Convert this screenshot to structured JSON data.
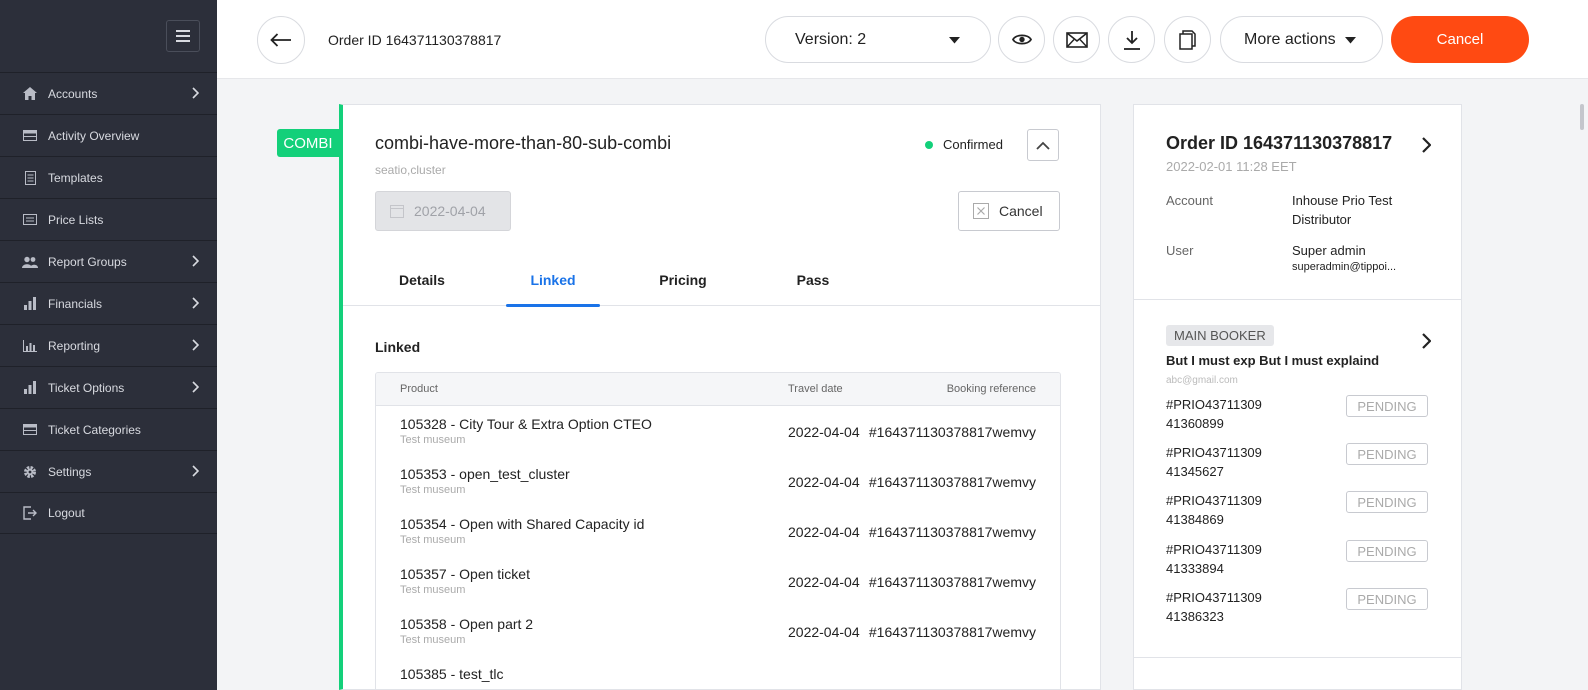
{
  "sidebar": {
    "items": [
      {
        "label": "Accounts",
        "icon": "home-icon",
        "has_children": true
      },
      {
        "label": "Activity Overview",
        "icon": "table-icon",
        "has_children": false
      },
      {
        "label": "Templates",
        "icon": "document-icon",
        "has_children": false
      },
      {
        "label": "Price Lists",
        "icon": "list-icon",
        "has_children": false
      },
      {
        "label": "Report Groups",
        "icon": "users-icon",
        "has_children": true
      },
      {
        "label": "Financials",
        "icon": "bar-chart-icon",
        "has_children": true
      },
      {
        "label": "Reporting",
        "icon": "chart-icon",
        "has_children": true
      },
      {
        "label": "Ticket Options",
        "icon": "bar-chart-icon",
        "has_children": true
      },
      {
        "label": "Ticket Categories",
        "icon": "table-icon",
        "has_children": false
      },
      {
        "label": "Settings",
        "icon": "gear-icon",
        "has_children": true
      },
      {
        "label": "Logout",
        "icon": "logout-icon",
        "has_children": false
      }
    ]
  },
  "header": {
    "order_title": "Order ID 164371130378817",
    "version_label": "Version: 2",
    "more_actions": "More actions",
    "cancel": "Cancel"
  },
  "colors": {
    "accent_green": "#13d07a",
    "danger_orange": "#ff4a12",
    "link_blue": "#1a73e8",
    "sidebar_bg": "#2c2f3a"
  },
  "product": {
    "tag": "COMBI",
    "title": "combi-have-more-than-80-sub-combi",
    "subtitle": "seatio,cluster",
    "status": "Confirmed",
    "date": "2022-04-04",
    "cancel": "Cancel",
    "tabs": [
      "Details",
      "Linked",
      "Pricing",
      "Pass"
    ],
    "active_tab": "Linked",
    "section_title": "Linked",
    "table": {
      "headers": {
        "product": "Product",
        "travel_date": "Travel date",
        "booking_reference": "Booking reference"
      },
      "rows": [
        {
          "name": "105328 - City Tour & Extra Option CTEO",
          "museum": "Test museum",
          "date": "2022-04-04",
          "ref": "#164371130378817wemvy"
        },
        {
          "name": "105353 - open_test_cluster",
          "museum": "Test museum",
          "date": "2022-04-04",
          "ref": "#164371130378817wemvy"
        },
        {
          "name": "105354 - Open with Shared Capacity id",
          "museum": "Test museum",
          "date": "2022-04-04",
          "ref": "#164371130378817wemvy"
        },
        {
          "name": "105357 - Open ticket",
          "museum": "Test museum",
          "date": "2022-04-04",
          "ref": "#164371130378817wemvy"
        },
        {
          "name": "105358 - Open part 2",
          "museum": "Test museum",
          "date": "2022-04-04",
          "ref": "#164371130378817wemvy"
        },
        {
          "name": "105385 - test_tlc",
          "museum": "",
          "date": "",
          "ref": ""
        }
      ]
    }
  },
  "summary": {
    "order_id": "Order ID 164371130378817",
    "date": "2022-02-01 11:28 EET",
    "account_label": "Account",
    "account_value": "Inhouse Prio Test Distributor",
    "user_label": "User",
    "user_value": "Super admin",
    "user_email": "superadmin@tippoi...",
    "booker_badge": "MAIN BOOKER",
    "booker_name": "But I must exp But I must explaind",
    "booker_email": "abc@gmail.com",
    "tickets": [
      {
        "line1": "#PRIO43711309",
        "line2": "41360899",
        "status": "PENDING"
      },
      {
        "line1": "#PRIO43711309",
        "line2": "41345627",
        "status": "PENDING"
      },
      {
        "line1": "#PRIO43711309",
        "line2": "41384869",
        "status": "PENDING"
      },
      {
        "line1": "#PRIO43711309",
        "line2": "41333894",
        "status": "PENDING"
      },
      {
        "line1": "#PRIO43711309",
        "line2": "41386323",
        "status": "PENDING"
      }
    ]
  }
}
